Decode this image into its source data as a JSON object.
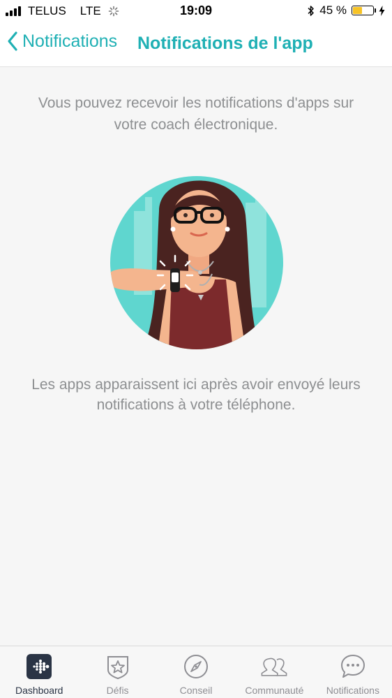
{
  "status_bar": {
    "carrier": "TELUS",
    "network": "LTE",
    "time": "19:09",
    "battery_percent_label": "45 %",
    "battery_level": 0.45,
    "battery_color": "#f7c325"
  },
  "header": {
    "back_label": "Notifications",
    "title": "Notifications de l'app",
    "accent_color": "#1fb0b4"
  },
  "main": {
    "intro_text": "Vous pouvez recevoir les notifications d'apps sur votre coach électronique.",
    "info_text": "Les apps apparaissent ici après avoir envoyé leurs notifications à votre téléphone.",
    "illustration": "woman-with-fitness-tracker-illustration"
  },
  "tab_bar": {
    "tabs": [
      {
        "label": "Dashboard",
        "icon": "dashboard-icon",
        "active": true
      },
      {
        "label": "Défis",
        "icon": "badge-star-icon",
        "active": false
      },
      {
        "label": "Conseil",
        "icon": "compass-icon",
        "active": false
      },
      {
        "label": "Communauté",
        "icon": "people-icon",
        "active": false
      },
      {
        "label": "Notifications",
        "icon": "chat-bubble-icon",
        "active": false
      }
    ]
  }
}
